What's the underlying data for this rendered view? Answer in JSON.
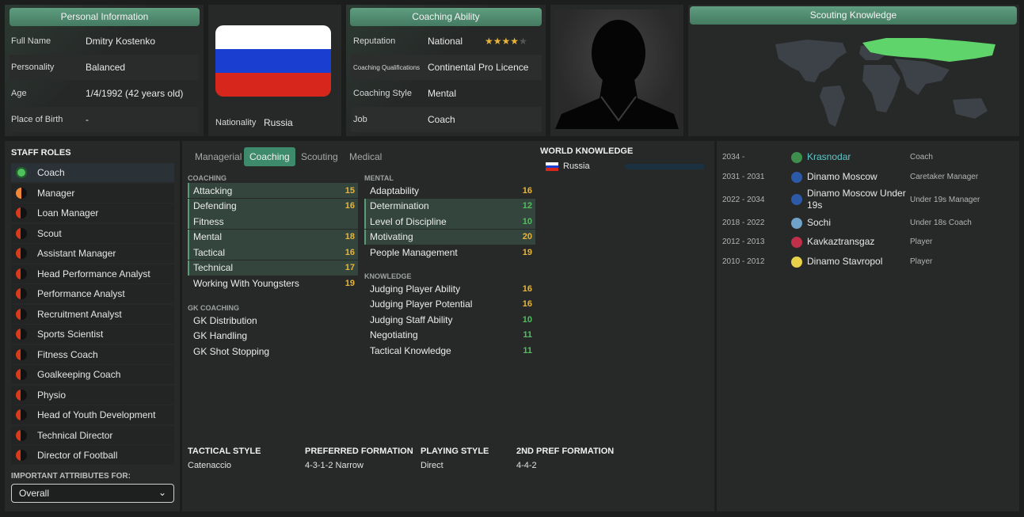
{
  "personal": {
    "header": "Personal Information",
    "rows": [
      {
        "label": "Full Name",
        "value": "Dmitry Kostenko"
      },
      {
        "label": "Personality",
        "value": "Balanced"
      },
      {
        "label": "Age",
        "value": "1/4/1992 (42 years old)"
      },
      {
        "label": "Place of Birth",
        "value": "-"
      }
    ]
  },
  "nationality": {
    "label": "Nationality",
    "value": "Russia",
    "flag_colors": [
      "#ffffff",
      "#1a3fd0",
      "#d7261c"
    ]
  },
  "coaching_ability": {
    "header": "Coaching Ability",
    "rows": [
      {
        "label": "Reputation",
        "value": "National"
      },
      {
        "label": "Coaching Qualifications",
        "value": "Continental Pro Licence"
      },
      {
        "label": "Coaching Style",
        "value": "Mental"
      },
      {
        "label": "Job",
        "value": "Coach"
      }
    ],
    "reputation_stars": 4,
    "reputation_stars_max": 5
  },
  "scouting": {
    "header": "Scouting Knowledge"
  },
  "staff_roles": {
    "title": "STAFF ROLES",
    "roles": [
      {
        "label": "Coach",
        "status": "full"
      },
      {
        "label": "Manager",
        "status": "good"
      },
      {
        "label": "Loan Manager",
        "status": "poor"
      },
      {
        "label": "Scout",
        "status": "poor"
      },
      {
        "label": "Assistant Manager",
        "status": "poor"
      },
      {
        "label": "Head Performance Analyst",
        "status": "poor"
      },
      {
        "label": "Performance Analyst",
        "status": "poor"
      },
      {
        "label": "Recruitment Analyst",
        "status": "poor"
      },
      {
        "label": "Sports Scientist",
        "status": "poor"
      },
      {
        "label": "Fitness Coach",
        "status": "poor"
      },
      {
        "label": "Goalkeeping Coach",
        "status": "poor"
      },
      {
        "label": "Physio",
        "status": "poor"
      },
      {
        "label": "Head of Youth Development",
        "status": "poor"
      },
      {
        "label": "Technical Director",
        "status": "poor"
      },
      {
        "label": "Director of Football",
        "status": "poor"
      }
    ],
    "important_label": "IMPORTANT ATTRIBUTES FOR:",
    "important_value": "Overall"
  },
  "tabs": [
    "Managerial",
    "Coaching",
    "Scouting",
    "Medical"
  ],
  "active_tab": "Coaching",
  "coaching": {
    "title": "COACHING",
    "items": [
      {
        "label": "Attacking",
        "value": "15",
        "hl": true,
        "color": "yel"
      },
      {
        "label": "Defending",
        "value": "16",
        "hl": true,
        "color": "yel"
      },
      {
        "label": "Fitness",
        "value": "",
        "hl": true,
        "color": "yel"
      },
      {
        "label": "Mental",
        "value": "18",
        "hl": true,
        "color": "yel"
      },
      {
        "label": "Tactical",
        "value": "16",
        "hl": true,
        "color": "yel"
      },
      {
        "label": "Technical",
        "value": "17",
        "hl": true,
        "color": "yel"
      },
      {
        "label": "Working With Youngsters",
        "value": "19",
        "hl": false,
        "color": "yel"
      }
    ]
  },
  "gk_coaching": {
    "title": "GK COACHING",
    "items": [
      {
        "label": "GK Distribution",
        "value": "",
        "hl": false,
        "color": "yel"
      },
      {
        "label": "GK Handling",
        "value": "",
        "hl": false,
        "color": "yel"
      },
      {
        "label": "GK Shot Stopping",
        "value": "",
        "hl": false,
        "color": "yel"
      }
    ]
  },
  "mental": {
    "title": "MENTAL",
    "items": [
      {
        "label": "Adaptability",
        "value": "16",
        "hl": false,
        "color": "yel"
      },
      {
        "label": "Determination",
        "value": "12",
        "hl": true,
        "color": "grn"
      },
      {
        "label": "Level of Discipline",
        "value": "10",
        "hl": true,
        "color": "grn"
      },
      {
        "label": "Motivating",
        "value": "20",
        "hl": true,
        "color": "yel"
      },
      {
        "label": "People Management",
        "value": "19",
        "hl": false,
        "color": "yel"
      }
    ]
  },
  "knowledge": {
    "title": "KNOWLEDGE",
    "items": [
      {
        "label": "Judging Player Ability",
        "value": "16",
        "hl": false,
        "color": "yel"
      },
      {
        "label": "Judging Player Potential",
        "value": "16",
        "hl": false,
        "color": "yel"
      },
      {
        "label": "Judging Staff Ability",
        "value": "10",
        "hl": false,
        "color": "grn"
      },
      {
        "label": "Negotiating",
        "value": "11",
        "hl": false,
        "color": "grn"
      },
      {
        "label": "Tactical Knowledge",
        "value": "11",
        "hl": false,
        "color": "grn"
      }
    ]
  },
  "world_knowledge": {
    "title": "WORLD KNOWLEDGE",
    "country": "Russia",
    "level": 0.0
  },
  "history": [
    {
      "years": "2034 -",
      "club": "Krasnodar",
      "role": "Coach",
      "crest": "#3e8f4d",
      "current": true
    },
    {
      "years": "2031 - 2031",
      "club": "Dinamo Moscow",
      "role": "Caretaker Manager",
      "crest": "#2c5aa8",
      "current": false
    },
    {
      "years": "2022 - 2034",
      "club": "Dinamo Moscow Under 19s",
      "role": "Under 19s Manager",
      "crest": "#2c5aa8",
      "current": false
    },
    {
      "years": "2018 - 2022",
      "club": "Sochi",
      "role": "Under 18s Coach",
      "crest": "#6fa3c9",
      "current": false
    },
    {
      "years": "2012 - 2013",
      "club": "Kavkaztransgaz",
      "role": "Player",
      "crest": "#c0304a",
      "current": false
    },
    {
      "years": "2010 - 2012",
      "club": "Dinamo Stavropol",
      "role": "Player",
      "crest": "#e8d24a",
      "current": false
    }
  ],
  "tactics": {
    "tactical_style_label": "TACTICAL STYLE",
    "tactical_style": "Catenaccio",
    "formation_label": "PREFERRED FORMATION",
    "formation": "4-3-1-2 Narrow",
    "playing_style_label": "PLAYING STYLE",
    "playing_style": "Direct",
    "second_formation_label": "2ND PREF FORMATION",
    "second_formation": "4-4-2"
  },
  "colors": {
    "accent": "#3e8a6c",
    "star": "#e8b53a",
    "good": "#4fc05d"
  }
}
